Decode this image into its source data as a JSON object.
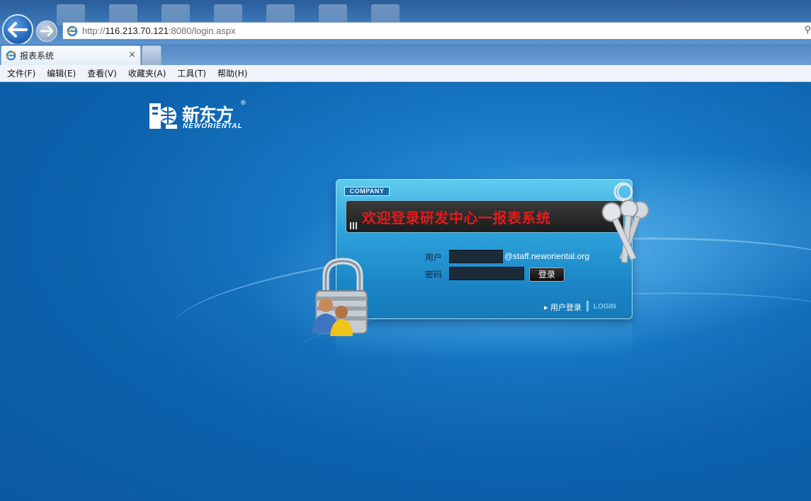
{
  "browser": {
    "address": {
      "prefix": "http://",
      "host": "116.213.70.121",
      "rest": ":8080/login.aspx"
    },
    "tab": {
      "title": "报表系统",
      "close": "×"
    }
  },
  "menu": [
    {
      "label": "文件(F)"
    },
    {
      "label": "编辑(E)"
    },
    {
      "label": "查看(V)"
    },
    {
      "label": "收藏夹(A)"
    },
    {
      "label": "工具(T)"
    },
    {
      "label": "帮助(H)"
    }
  ],
  "logo": {
    "cn": "新东方",
    "en": "NEWORIENTAL",
    "mark": "®"
  },
  "login": {
    "company_tag": "COMPANY",
    "banner": "欢迎登录研发中心一报表系统",
    "username_label": "用户",
    "username_value": "",
    "email_suffix": "@staff.neworiental.org",
    "password_label": "密码",
    "password_value": "",
    "submit_label": "登录",
    "footer_link": "▸ 用户登录",
    "footer_login": "LOGIN"
  },
  "colors": {
    "page_bg": "#0a5fa6",
    "card": "#2fa4dc",
    "banner_text": "#e11b1b"
  },
  "icons": [
    "back-arrow-icon",
    "forward-arrow-icon",
    "ie-icon",
    "search-icon",
    "padlock-icon",
    "keys-icon",
    "users-icon"
  ]
}
